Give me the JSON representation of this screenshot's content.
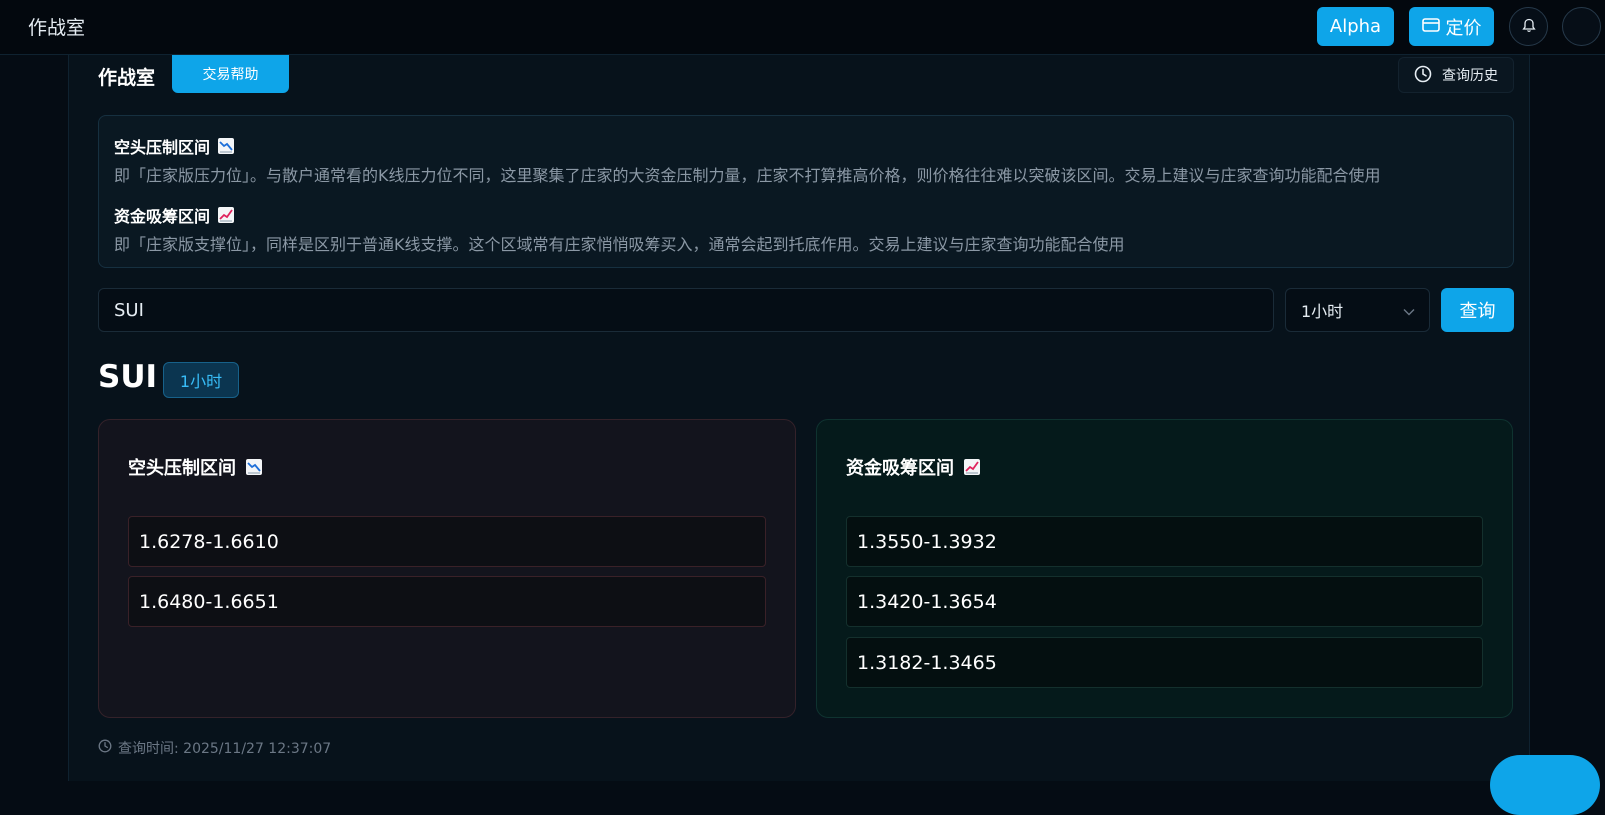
{
  "topbar": {
    "app_title": "作战室",
    "alpha_label": "Alpha",
    "pricing_label": "定价",
    "icons": {
      "pricing": "credit-card-icon",
      "notifications": "bell-icon"
    },
    "accent": "#0ea5e9"
  },
  "header": {
    "title": "作战室",
    "help_label": "交易帮助",
    "history_label": "查询历史",
    "history_icon": "clock-icon"
  },
  "info": {
    "short_title": "空头压制区间",
    "short_emoji": "chart-decreasing-icon",
    "short_desc": "即「庄家版压力位」。与散户通常看的K线压力位不同，这里聚集了庄家的大资金压制力量，庄家不打算推高价格，则价格往往难以突破该区间。交易上建议与庄家查询功能配合使用",
    "long_title": "资金吸筹区间",
    "long_emoji": "chart-increasing-icon",
    "long_desc": "即「庄家版支撑位」，同样是区别于普通K线支撑。这个区域常有庄家悄悄吸筹买入，通常会起到托底作用。交易上建议与庄家查询功能配合使用"
  },
  "search": {
    "value": "SUI",
    "interval": "1小时",
    "query_label": "查询"
  },
  "result": {
    "symbol": "SUI",
    "interval": "1小时",
    "short_panel": {
      "title": "空头压制区间",
      "zones": [
        "1.6278-1.6610",
        "1.6480-1.6651"
      ],
      "accent": "#34222a"
    },
    "long_panel": {
      "title": "资金吸筹区间",
      "zones": [
        "1.3550-1.3932",
        "1.3420-1.3654",
        "1.3182-1.3465"
      ],
      "accent": "#0f3330"
    },
    "query_time": "查询时间: 2025/11/27 12:37:07"
  }
}
